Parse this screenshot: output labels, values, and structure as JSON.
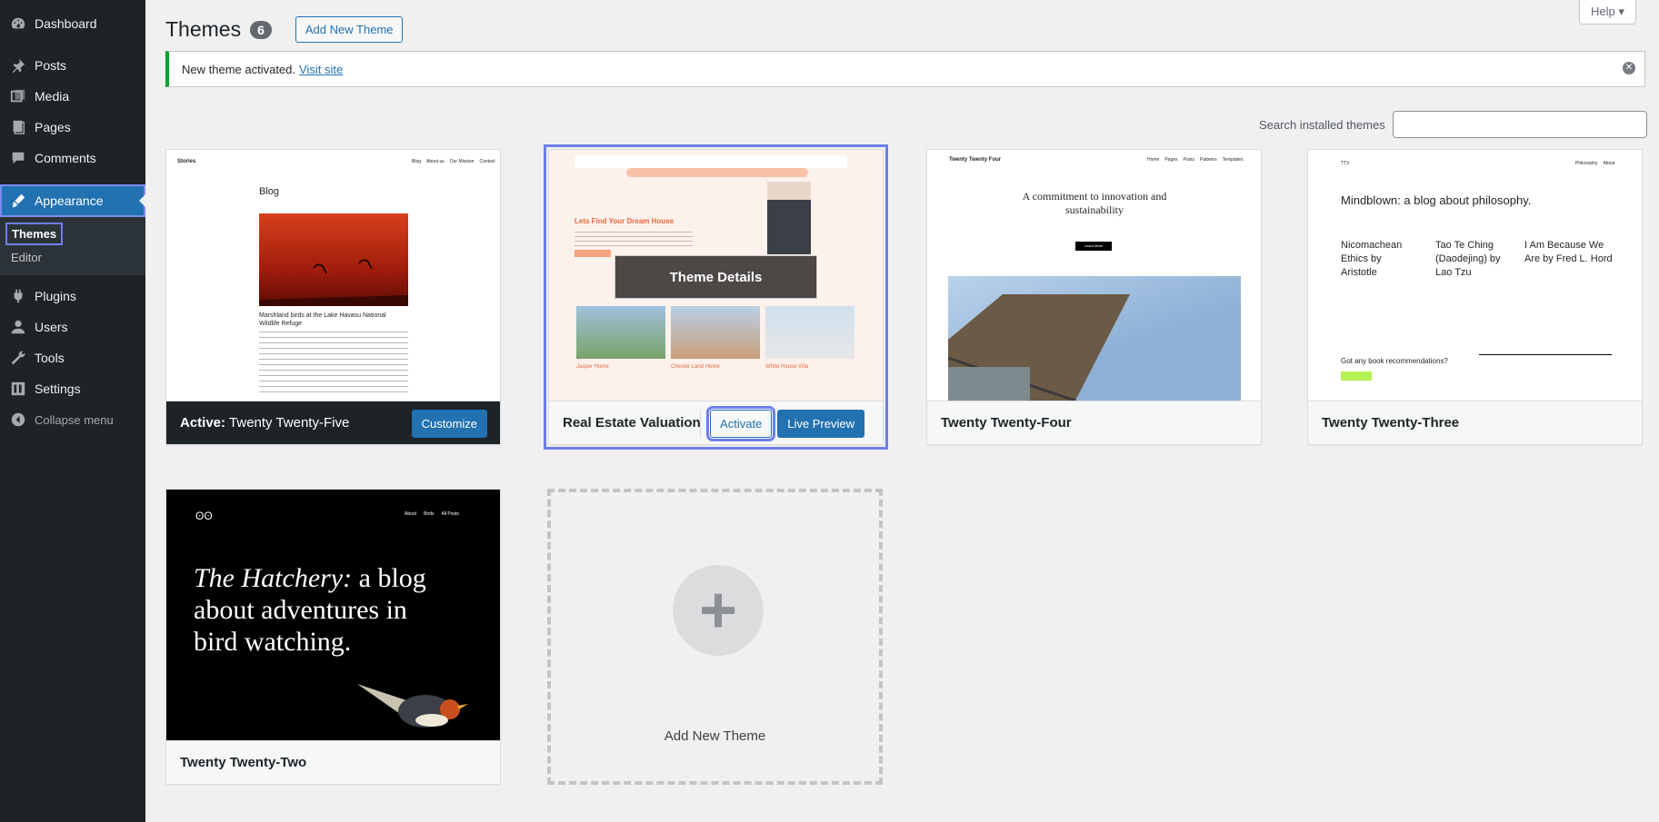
{
  "sidebar": {
    "items": [
      {
        "label": "Dashboard",
        "icon": "dashboard-icon"
      },
      {
        "label": "Posts",
        "icon": "pin-icon"
      },
      {
        "label": "Media",
        "icon": "media-icon"
      },
      {
        "label": "Pages",
        "icon": "pages-icon"
      },
      {
        "label": "Comments",
        "icon": "comment-icon"
      },
      {
        "label": "Appearance",
        "icon": "brush-icon"
      },
      {
        "label": "Plugins",
        "icon": "plugin-icon"
      },
      {
        "label": "Users",
        "icon": "users-icon"
      },
      {
        "label": "Tools",
        "icon": "wrench-icon"
      },
      {
        "label": "Settings",
        "icon": "settings-icon"
      }
    ],
    "submenu": {
      "themes": "Themes",
      "editor": "Editor"
    },
    "collapse": "Collapse menu"
  },
  "header": {
    "title": "Themes",
    "count": "6",
    "add_new": "Add New Theme",
    "help": "Help ▾"
  },
  "notice": {
    "text": "New theme activated.",
    "link": "Visit site"
  },
  "search": {
    "label": "Search installed themes",
    "value": ""
  },
  "themes": {
    "t1": {
      "active_label": "Active:",
      "name": "Twenty Twenty-Five",
      "customize": "Customize",
      "preview": {
        "site": "Stories",
        "nav": [
          "Blog",
          "About us",
          "Our Mission",
          "Contact"
        ],
        "heading": "Blog",
        "caption": "Marshland birds at the Lake Havasu National Wildlife Refuge"
      }
    },
    "t2": {
      "name": "Real Estate Valuation",
      "details": "Theme Details",
      "activate": "Activate",
      "live_preview": "Live Preview",
      "preview": {
        "headline": "Lets Find Your Dream House",
        "cards": [
          "Jasper Home",
          "Chester Land Home",
          "White House Villa"
        ]
      }
    },
    "t3": {
      "name": "Twenty Twenty-Four",
      "preview": {
        "site": "Twenty Twenty Four",
        "nav": [
          "Home",
          "Pages",
          "Posts",
          "Patterns",
          "Templates"
        ],
        "headline": "A commitment to innovation and sustainability",
        "button": "Learn More"
      }
    },
    "t4": {
      "name": "Twenty Twenty-Three",
      "preview": {
        "site": "TT3",
        "nav": [
          "Philosophy",
          "About"
        ],
        "headline": "Mindblown: a blog about philosophy.",
        "posts": [
          "Nicomachean Ethics by Aristotle",
          "Tao Te Ching (Daodejing) by Lao Tzu",
          "I Am Because We Are by Fred L. Hord"
        ],
        "footer_q": "Got any book recommendations?"
      }
    },
    "t5": {
      "name": "Twenty Twenty-Two",
      "preview": {
        "nav": [
          "About",
          "Birds",
          "All Posts"
        ],
        "headline_italic": "The Hatchery:",
        "headline": " a blog about adventures in bird watching."
      }
    }
  },
  "add_new_card": {
    "label": "Add New Theme"
  },
  "colors": {
    "accent": "#2271b1",
    "sidebar": "#1d2327",
    "success": "#00a32a",
    "focus": "#6d7fe8"
  }
}
